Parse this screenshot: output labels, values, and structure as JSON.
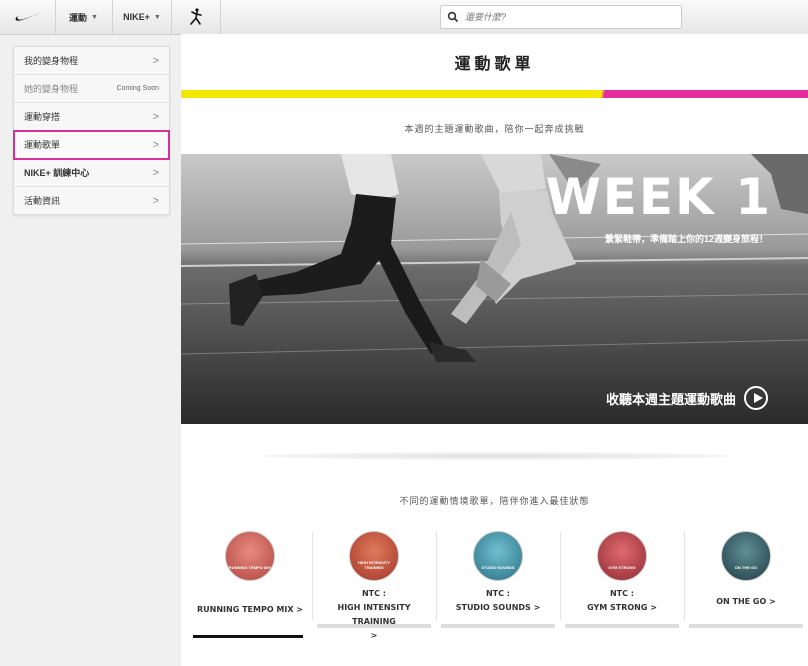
{
  "topbar": {
    "logo": "nike-swoosh-icon",
    "menu1": "運動",
    "menu2": "NIKE+",
    "jordan": "jumpman-icon",
    "search_placeholder": "還要什麼?"
  },
  "sidebar": {
    "items": [
      {
        "label": "我的變身物程",
        "suffix": ">"
      },
      {
        "label": "她的變身物程",
        "suffix": "Coming Soon"
      },
      {
        "label": "運動穿搭",
        "suffix": ">"
      },
      {
        "label": "運動歌單",
        "suffix": ">"
      },
      {
        "label": "NIKE+ 訓練中心",
        "suffix": ">"
      },
      {
        "label": "活動資訊",
        "suffix": ">"
      }
    ]
  },
  "main": {
    "title": "運動歌單",
    "intro": "本週的主題運動歌曲，陪你一起奔成挑戰",
    "hero": {
      "week": "WEEK 1",
      "subtitle": "繫緊鞋帶，準備踏上你的12週變身旅程！",
      "cta": "收聽本週主題運動歌曲"
    },
    "intro2": "不同的運動情境歌單，陪伴你進入最佳狀態",
    "cards": [
      {
        "line1": "RUNNING TEMPO MIX >",
        "line2": "",
        "line3": "",
        "thumb": "RUNNING TEMPO MIX",
        "color": "#c0564e"
      },
      {
        "line1": "NTC :",
        "line2": "HIGH INTENSITY TRAINING",
        "line3": ">",
        "thumb": "HIGH INTENSITY TRAINING",
        "color": "#c24a3c"
      },
      {
        "line1": "NTC :",
        "line2": "STUDIO SOUNDS >",
        "line3": "",
        "thumb": "STUDIO SOUNDS",
        "color": "#3b8fa5"
      },
      {
        "line1": "NTC :",
        "line2": "GYM STRONG >",
        "line3": "",
        "thumb": "GYM STRONG",
        "color": "#b43d44"
      },
      {
        "line1": "ON THE GO >",
        "line2": "",
        "line3": "",
        "thumb": "ON THE GO",
        "color": "#2f5866"
      }
    ]
  }
}
